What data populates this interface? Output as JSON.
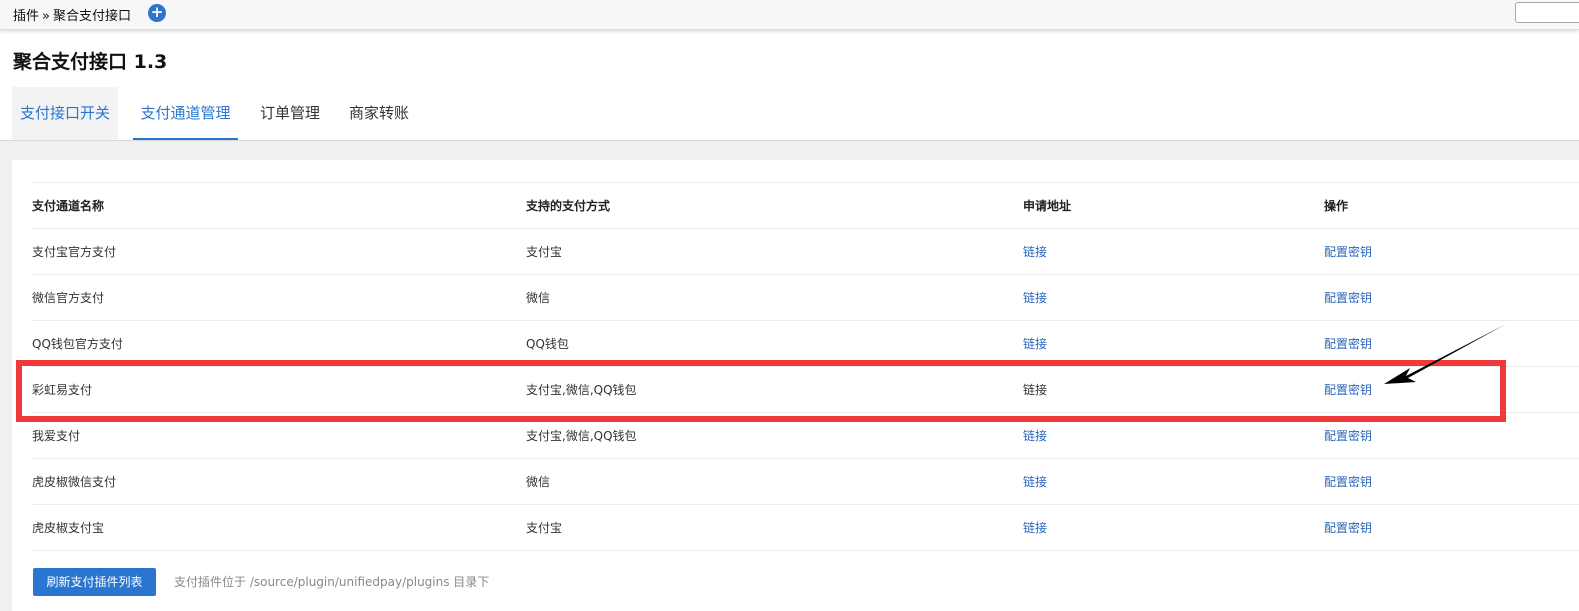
{
  "breadcrumb": {
    "root": "插件",
    "separator": "»",
    "current": "聚合支付接口"
  },
  "page_title": "聚合支付接口 1.3",
  "tabs": [
    {
      "label": "支付接口开关"
    },
    {
      "label": "支付通道管理"
    },
    {
      "label": "订单管理"
    },
    {
      "label": "商家转账"
    }
  ],
  "table": {
    "headers": [
      "支付通道名称",
      "支持的支付方式",
      "申请地址",
      "操作"
    ],
    "rows": [
      {
        "name": "支付宝官方支付",
        "methods": "支付宝",
        "apply": "链接",
        "action": "配置密钥"
      },
      {
        "name": "微信官方支付",
        "methods": "微信",
        "apply": "链接",
        "action": "配置密钥"
      },
      {
        "name": "QQ钱包官方支付",
        "methods": "QQ钱包",
        "apply": "链接",
        "action": "配置密钥"
      },
      {
        "name": "彩虹易支付",
        "methods": "支付宝,微信,QQ钱包",
        "apply": "链接",
        "action": "配置密钥"
      },
      {
        "name": "我爱支付",
        "methods": "支付宝,微信,QQ钱包",
        "apply": "链接",
        "action": "配置密钥"
      },
      {
        "name": "虎皮椒微信支付",
        "methods": "微信",
        "apply": "链接",
        "action": "配置密钥"
      },
      {
        "name": "虎皮椒支付宝",
        "methods": "支付宝",
        "apply": "链接",
        "action": "配置密钥"
      }
    ]
  },
  "footer": {
    "refresh_button": "刷新支付插件列表",
    "tip": "支付插件位于 /source/plugin/unifiedpay/plugins 目录下"
  },
  "colors": {
    "accent": "#2a75d0",
    "link": "#2a66b8",
    "highlight": "#f0393b"
  },
  "icons": {
    "add": "plus-circle-icon",
    "annotation": "arrow-icon"
  }
}
